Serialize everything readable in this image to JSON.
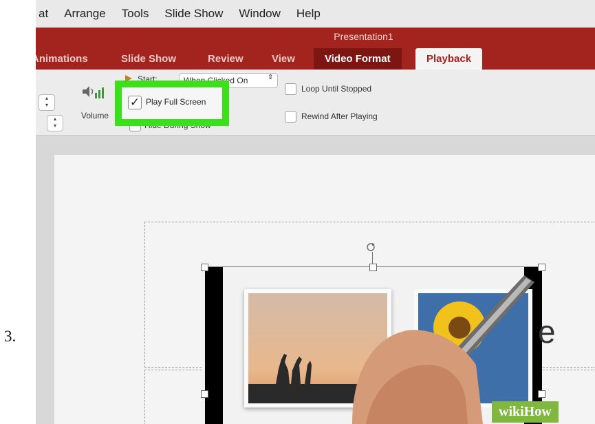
{
  "step": {
    "number": "3."
  },
  "menubar": {
    "items": [
      {
        "label": "at"
      },
      {
        "label": "Arrange"
      },
      {
        "label": "Tools"
      },
      {
        "label": "Slide Show"
      },
      {
        "label": "Window"
      },
      {
        "label": "Help"
      }
    ]
  },
  "window": {
    "title": "Presentation1"
  },
  "ribbon_tabs": {
    "animations": "Animations",
    "slide_show": "Slide Show",
    "review": "Review",
    "view": "View",
    "video_format": "Video Format",
    "playback": "Playback"
  },
  "ribbon": {
    "volume_label": "Volume",
    "start_label": "Start:",
    "start_value": "When Clicked On",
    "play_full_screen_label": "Play Full Screen",
    "hide_during_show_label": "Hide During Show",
    "loop_label": "Loop Until Stopped",
    "rewind_label": "Rewind After Playing"
  },
  "slide": {
    "partial_text": "e"
  },
  "watermark": {
    "text": "wikiHow"
  },
  "colors": {
    "ribbon_red": "#a3231f",
    "active_tab": "#7d1513",
    "highlight_green": "#3ce01a"
  }
}
